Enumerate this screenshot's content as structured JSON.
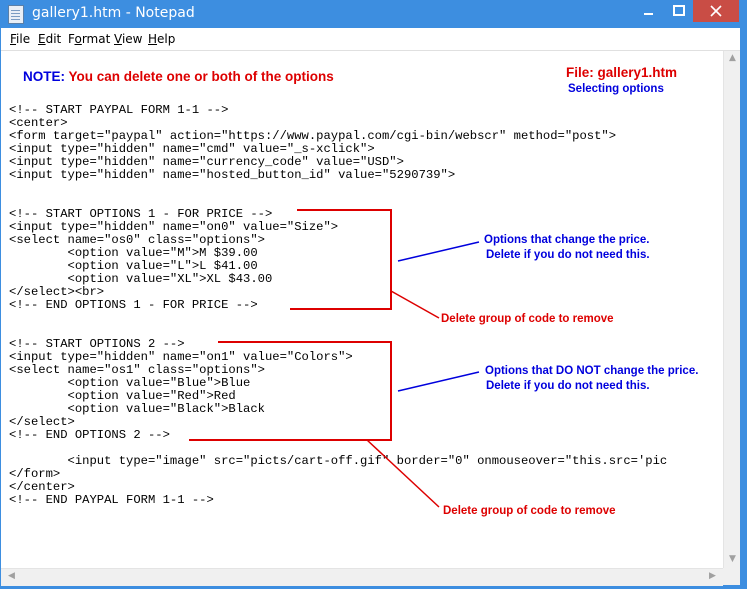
{
  "window": {
    "title": "gallery1.htm - Notepad",
    "icon": "notepad-icon"
  },
  "menu": [
    {
      "pre": "",
      "key": "F",
      "post": "ile"
    },
    {
      "pre": "",
      "key": "E",
      "post": "dit"
    },
    {
      "pre": "F",
      "key": "o",
      "post": "rmat"
    },
    {
      "pre": "",
      "key": "V",
      "post": "iew"
    },
    {
      "pre": "",
      "key": "H",
      "post": "elp"
    }
  ],
  "notes": {
    "main_prefix": "NOTE:",
    "main_text": " You can delete one or both of the options",
    "file_label": "File: gallery1.htm",
    "file_sub": "Selecting options"
  },
  "code": {
    "block1": "<!-- START PAYPAL FORM 1-1 -->\n<center>\n<form target=\"paypal\" action=\"https://www.paypal.com/cgi-bin/webscr\" method=\"post\">\n<input type=\"hidden\" name=\"cmd\" value=\"_s-xclick\">\n<input type=\"hidden\" name=\"currency_code\" value=\"USD\">\n<input type=\"hidden\" name=\"hosted_button_id\" value=\"5290739\">",
    "block2": "<!-- START OPTIONS 1 - FOR PRICE -->\n<input type=\"hidden\" name=\"on0\" value=\"Size\">\n<select name=\"os0\" class=\"options\">\n        <option value=\"M\">M $39.00\n        <option value=\"L\">L $41.00\n        <option value=\"XL\">XL $43.00\n</select><br>\n<!-- END OPTIONS 1 - FOR PRICE -->",
    "block3": "<!-- START OPTIONS 2 -->\n<input type=\"hidden\" name=\"on1\" value=\"Colors\">\n<select name=\"os1\" class=\"options\">\n        <option value=\"Blue\">Blue\n        <option value=\"Red\">Red\n        <option value=\"Black\">Black\n</select>\n<!-- END OPTIONS 2 -->",
    "block4": "        <input type=\"image\" src=\"picts/cart-off.gif\" border=\"0\" onmouseover=\"this.src='pic\n</form>\n</center>\n<!-- END PAYPAL FORM 1-1 -->"
  },
  "annotations": {
    "opt1_line1": "Options that change the price.",
    "opt1_line2": "Delete if you do not need this.",
    "opt2_line1": "Options that DO NOT change the price.",
    "opt2_line2": "Delete if you do not need this.",
    "delete1": "Delete group of code to remove",
    "delete2": "Delete group of code to remove"
  },
  "colors": {
    "titlebar": "#3d8ee0",
    "close_button": "#c94d45",
    "annotation_red": "#dd0000",
    "annotation_blue": "#0000dd"
  }
}
